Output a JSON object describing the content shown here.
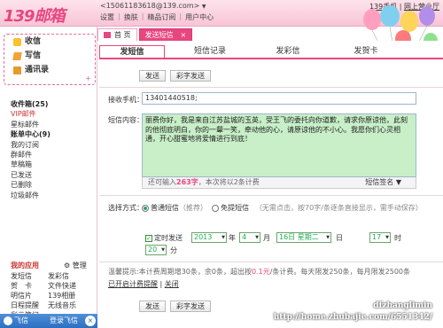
{
  "header": {
    "logo": "139邮箱",
    "account": "<15061183618@139.com>",
    "account_arrow": "▼",
    "nav": [
      "设置",
      "换肤",
      "精品订阅",
      "用户中心"
    ],
    "links": [
      "139手机",
      "网上营业厅"
    ]
  },
  "tabs": {
    "home": "首 页",
    "compose": "发送短信",
    "close": "×"
  },
  "sidebar": {
    "quick": [
      {
        "label": "收信",
        "icon": "inbox-icon"
      },
      {
        "label": "写信",
        "icon": "compose-icon"
      },
      {
        "label": "通讯录",
        "icon": "contacts-icon"
      }
    ],
    "quick_plus": "+",
    "folders": [
      {
        "label": "收件箱(25)",
        "bold": true
      },
      {
        "label": "VIP邮件",
        "vip": true
      },
      {
        "label": "星标邮件",
        "bold": true
      },
      {
        "label": "账单中心(9)",
        "bold": true
      },
      {
        "label": "我的订阅",
        "bold": false
      },
      {
        "label": "群邮件",
        "bold": false
      },
      {
        "label": "草稿箱",
        "bold": false
      },
      {
        "label": "已发送",
        "bold": false
      },
      {
        "label": "已删除",
        "bold": false
      },
      {
        "label": "垃圾邮件",
        "bold": false
      }
    ],
    "apps_title": "我的应用",
    "apps_manage": "管理",
    "apps_col1": [
      "发短信",
      "贺　卡",
      "明信片",
      "日程提醒",
      "彩云笔记"
    ],
    "apps_col2": [
      "发彩信",
      "文件快递",
      "139相册",
      "无线音乐"
    ],
    "fetion": "飞信",
    "fetion_login": "登录飞信",
    "fetion_close": "×"
  },
  "main": {
    "subtabs": [
      "发短信",
      "短信记录",
      "发彩信",
      "发贺卡"
    ],
    "send_label": "发送",
    "template_label": "彩字发送",
    "recipient_label": "接收手机：",
    "recipient_value": "13401440518;",
    "content_label": "短信内容：",
    "content_value": "丽费你好，我是来自江苏盐城的玉英，受王飞的委托向你道歉，请求你原谅他，此刻的他彻底明白，你的一颦一笑，牵动他的心，请原谅他的不小心。我愿你们心灵相通，开心甜蜜地将爱情进行到底！",
    "counter_prefix": "还可输入",
    "counter_value": "263字",
    "counter_suffix": "，本次将以2条计费",
    "signature": "短信签名",
    "mode_label": "选择方式：",
    "mode_normal": "普通短信",
    "mode_recommended": "（推荐）",
    "mode_free": "免提短信",
    "mode_free_note": "（无需点击，按70字/条逐条直接显示，需手动保存）",
    "timed_label": "定时发送",
    "year": "2013",
    "year_unit": "年",
    "month": "4",
    "month_unit": "月",
    "day": "16日 星期二",
    "day_unit": "日",
    "hour": "17",
    "hour_unit": "时",
    "minute": "20",
    "minute_unit": "分",
    "tip_prefix": "温馨提示:本计费周期增30条，余0条，超出按",
    "tip_rate": "0.1元",
    "tip_suffix": "/条计费。每天限发250条，每月限发2500条",
    "reminder": "已开启计费提醒",
    "close_link": "关闭"
  },
  "watermark": [
    "dfzhanglimin",
    "http://home.zhubajie.com/6551342/"
  ],
  "colors": {
    "accent": "#e8467e",
    "green": "#c8efc8"
  }
}
